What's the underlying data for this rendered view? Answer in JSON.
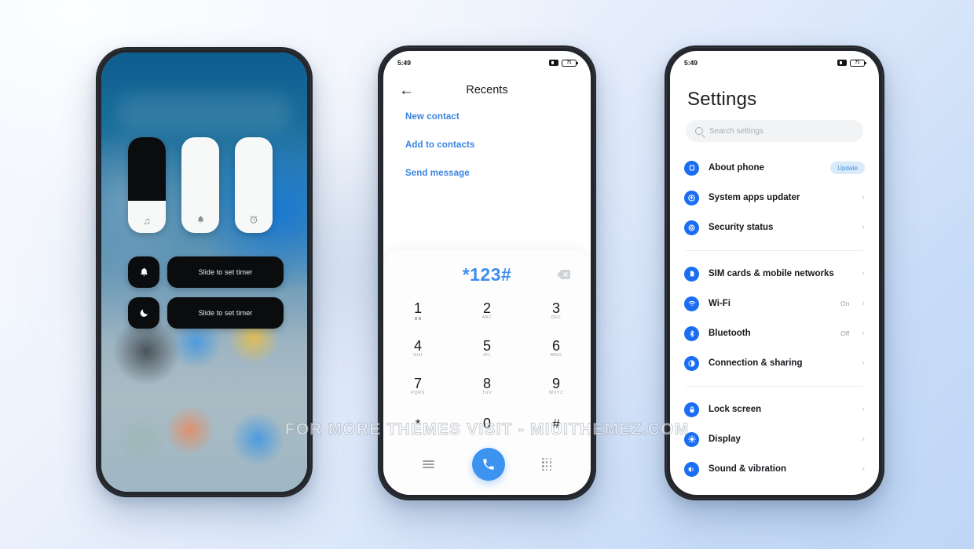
{
  "page": {
    "watermark": "FOR MORE THEMES VISIT - MIUITHEMEZ.COM",
    "bg_start": "#fbfcff",
    "bg_end": "#bfd6f6"
  },
  "status_bar": {
    "time": "5:49",
    "battery_level": "71",
    "signal_icon": "signal-icon",
    "battery_icon": "battery-icon"
  },
  "phone_left": {
    "name": "volume-control-panel",
    "sliders": [
      {
        "id": "media",
        "icon": "music-note-icon",
        "glyph": "♫",
        "fill_percent": 66
      },
      {
        "id": "ringtone",
        "icon": "bell-icon",
        "glyph": "🔔",
        "fill_percent": 0
      },
      {
        "id": "alarm",
        "icon": "alarm-clock-icon",
        "glyph": "⏰",
        "fill_percent": 0
      }
    ],
    "toggles": [
      {
        "icon": "bell-icon",
        "glyph": "🔔",
        "label": "Slide to set timer"
      },
      {
        "icon": "moon-icon",
        "glyph": "☾",
        "label": "Slide to set timer"
      }
    ]
  },
  "phone_mid": {
    "name": "dialer-screen",
    "back_icon": "back-arrow-icon",
    "title": "Recents",
    "links": [
      "New contact",
      "Add to contacts",
      "Send message"
    ],
    "dial": {
      "number": "*123#",
      "backspace_icon": "backspace-icon",
      "accent": "#3d8ef0"
    },
    "keys": [
      {
        "digit": "1",
        "sub": "",
        "voicemail": true
      },
      {
        "digit": "2",
        "sub": "ABC"
      },
      {
        "digit": "3",
        "sub": "DEF"
      },
      {
        "digit": "4",
        "sub": "GHI"
      },
      {
        "digit": "5",
        "sub": "JKL"
      },
      {
        "digit": "6",
        "sub": "MNO"
      },
      {
        "digit": "7",
        "sub": "PQRS"
      },
      {
        "digit": "8",
        "sub": "TUV"
      },
      {
        "digit": "9",
        "sub": "WXYZ"
      },
      {
        "digit": "*",
        "sub": ""
      },
      {
        "digit": "0",
        "sub": "+"
      },
      {
        "digit": "#",
        "sub": ""
      }
    ],
    "bottom": {
      "menu_icon": "hamburger-menu-icon",
      "call_icon": "phone-call-icon",
      "call_glyph": "📞",
      "keypad_icon": "keypad-grid-icon"
    }
  },
  "phone_right": {
    "name": "settings-screen",
    "title": "Settings",
    "search_placeholder": "Search settings",
    "search_icon": "search-icon",
    "icon_color": "#1b6ef3",
    "groups": [
      {
        "items": [
          {
            "label": "About phone",
            "icon": "phone-info-icon",
            "glyph": "□",
            "badge": "Update",
            "value": "",
            "chevron": false
          },
          {
            "label": "System apps updater",
            "icon": "up-arrow-circle-icon",
            "glyph": "↑",
            "value": "",
            "chevron": true
          },
          {
            "label": "Security status",
            "icon": "security-shield-icon",
            "glyph": "◎",
            "value": "",
            "chevron": true
          }
        ]
      },
      {
        "items": [
          {
            "label": "SIM cards & mobile networks",
            "icon": "sim-card-icon",
            "glyph": "▫",
            "value": "",
            "chevron": true
          },
          {
            "label": "Wi-Fi",
            "icon": "wifi-icon",
            "glyph": "◠",
            "value": "On",
            "chevron": true
          },
          {
            "label": "Bluetooth",
            "icon": "bluetooth-icon",
            "glyph": "ᛦ",
            "value": "Off",
            "chevron": true
          },
          {
            "label": "Connection & sharing",
            "icon": "connection-sharing-icon",
            "glyph": "◐",
            "value": "",
            "chevron": true
          }
        ]
      },
      {
        "items": [
          {
            "label": "Lock screen",
            "icon": "lock-icon",
            "glyph": "▬",
            "value": "",
            "chevron": true
          },
          {
            "label": "Display",
            "icon": "brightness-icon",
            "glyph": "☀",
            "value": "",
            "chevron": true
          },
          {
            "label": "Sound & vibration",
            "icon": "speaker-icon",
            "glyph": "◀",
            "value": "",
            "chevron": true
          }
        ]
      }
    ]
  }
}
